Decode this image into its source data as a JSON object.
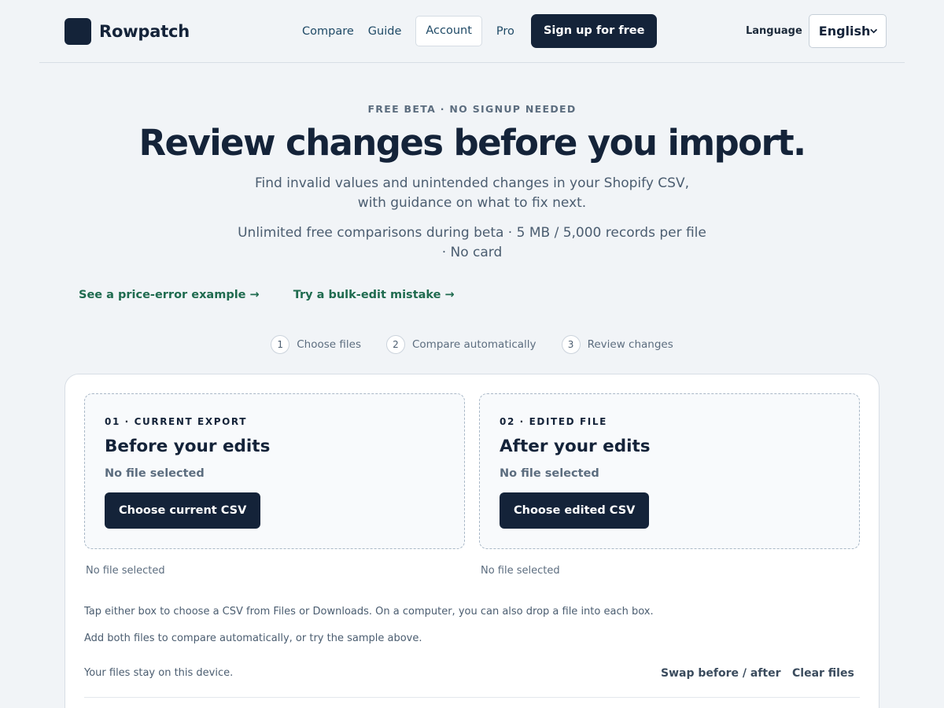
{
  "header": {
    "brand": "Rowpatch",
    "nav": {
      "compare": "Compare",
      "guide": "Guide",
      "account": "Account",
      "pro": "Pro",
      "signup": "Sign up for free"
    },
    "language_label": "Language",
    "language_value": "English"
  },
  "hero": {
    "eyebrow": "FREE BETA · NO SIGNUP NEEDED",
    "title": "Review changes before you import.",
    "subtitle": "Find invalid values and unintended changes in your Shopify CSV, with guidance on what to fix next.",
    "limits": "Unlimited free comparisons during beta · 5 MB / 5,000 records per file · No card"
  },
  "examples": {
    "price_error": "See a price-error example →",
    "bulk_edit": "Try a bulk-edit mistake →"
  },
  "steps": [
    {
      "num": "1",
      "label": "Choose files"
    },
    {
      "num": "2",
      "label": "Compare automatically"
    },
    {
      "num": "3",
      "label": "Review changes"
    }
  ],
  "upload": {
    "before": {
      "kicker": "01 · CURRENT EXPORT",
      "title": "Before your edits",
      "status": "No file selected",
      "button": "Choose current CSV",
      "note": "No file selected"
    },
    "after": {
      "kicker": "02 · EDITED FILE",
      "title": "After your edits",
      "status": "No file selected",
      "button": "Choose edited CSV",
      "note": "No file selected"
    },
    "help_line_1": "Tap either box to choose a CSV from Files or Downloads. On a computer, you can also drop a file into each box.",
    "help_line_2": "Add both files to compare automatically, or try the sample above.",
    "privacy": "Your files stay on this device.",
    "swap": "Swap before / after",
    "clear": "Clear files"
  }
}
